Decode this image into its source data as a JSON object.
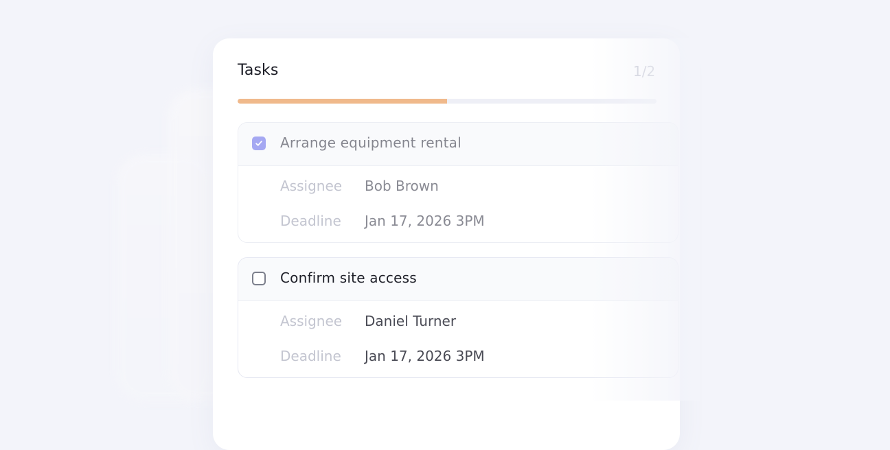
{
  "header": {
    "title": "Tasks",
    "page_counter": "1/2",
    "progress": 0.5
  },
  "colors": {
    "progress_fill": "#f0b98b",
    "checkbox_checked": "#a5a8f2"
  },
  "labels": {
    "assignee": "Assignee",
    "deadline": "Deadline"
  },
  "tasks": [
    {
      "title": "Arrange equipment rental",
      "completed": true,
      "assignee": "Bob Brown",
      "deadline": "Jan 17, 2026 3PM"
    },
    {
      "title": "Confirm site access",
      "completed": false,
      "assignee": "Daniel Turner",
      "deadline": "Jan 17, 2026 3PM"
    }
  ]
}
